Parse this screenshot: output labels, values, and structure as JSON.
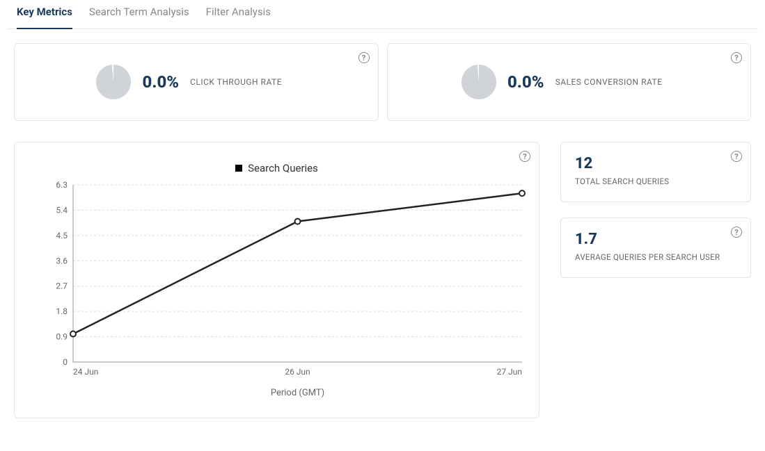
{
  "tabs": {
    "key_metrics": "Key Metrics",
    "search_term": "Search Term Analysis",
    "filter": "Filter Analysis"
  },
  "ctr": {
    "value": "0.0%",
    "label": "CLICK THROUGH RATE"
  },
  "scr": {
    "value": "0.0%",
    "label": "SALES CONVERSION RATE"
  },
  "total_queries": {
    "value": "12",
    "label": "TOTAL SEARCH QUERIES"
  },
  "avg_queries": {
    "value": "1.7",
    "label": "AVERAGE QUERIES PER SEARCH USER"
  },
  "chart_legend": "Search Queries",
  "chart_xlabel": "Period (GMT)",
  "chart_data": {
    "type": "line",
    "series_name": "Search Queries",
    "categories": [
      "24 Jun",
      "26 Jun",
      "27 Jun"
    ],
    "values": [
      1.0,
      5.0,
      6.0
    ],
    "xlabel": "Period (GMT)",
    "ylabel": "",
    "ylim": [
      0,
      6.3
    ],
    "yticks": [
      0,
      0.9,
      1.8,
      2.7,
      3.6,
      4.5,
      5.4,
      6.3
    ]
  },
  "help_glyph": "?"
}
